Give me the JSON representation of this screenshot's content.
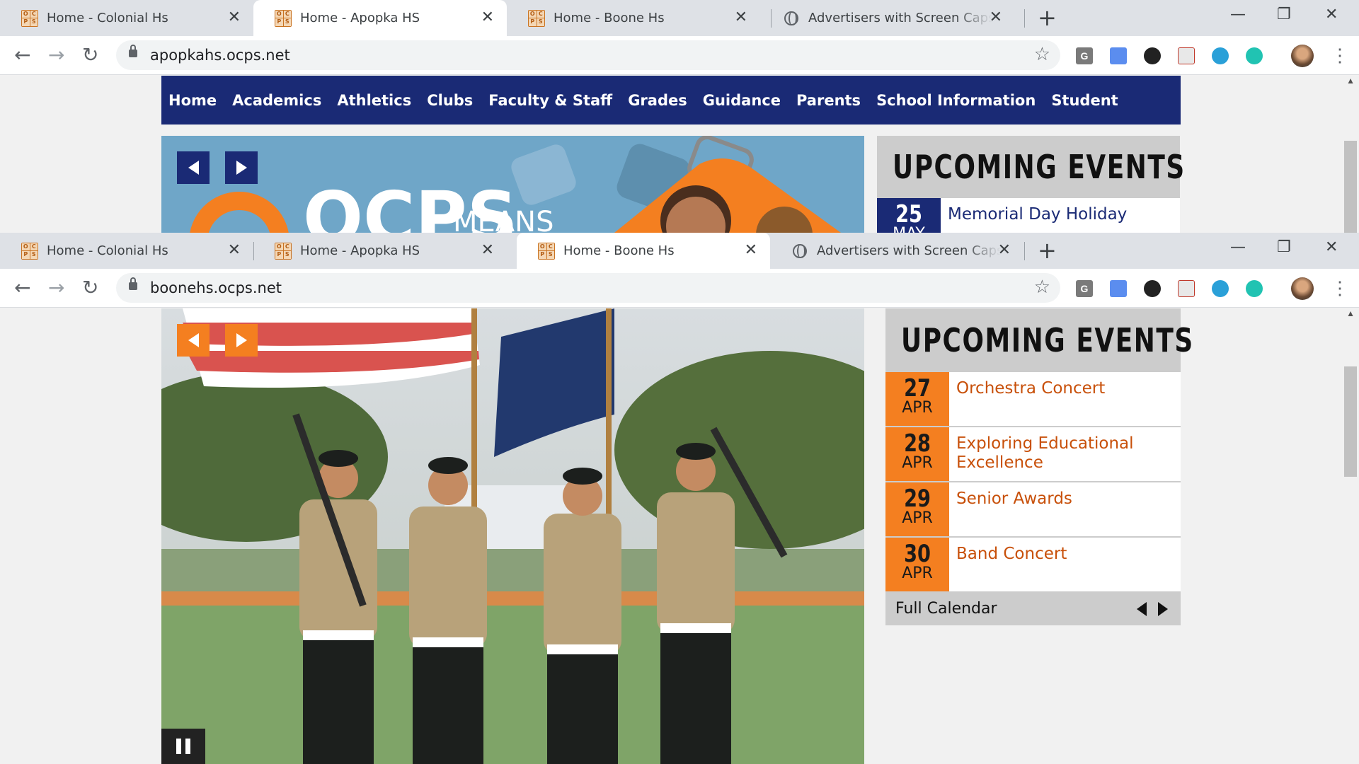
{
  "windows": [
    {
      "tabs": [
        {
          "title": "Home - Colonial Hs"
        },
        {
          "title": "Home - Apopka HS"
        },
        {
          "title": "Home - Boone Hs"
        },
        {
          "title": "Advertisers with Screen Caps of t"
        }
      ],
      "active_tab": 1,
      "url": "apopkahs.ocps.net",
      "nav": [
        "Home",
        "Academics",
        "Athletics",
        "Clubs",
        "Faculty & Staff",
        "Grades",
        "Guidance",
        "Parents",
        "School Information",
        "Student"
      ],
      "slide_text": {
        "brand": "OCPS",
        "tagline": "MEANS"
      },
      "events": {
        "heading": "UPCOMING EVENTS",
        "items": [
          {
            "day": "25",
            "month": "MAY",
            "title": "Memorial Day Holiday"
          }
        ]
      }
    },
    {
      "tabs": [
        {
          "title": "Home - Colonial Hs"
        },
        {
          "title": "Home - Apopka HS"
        },
        {
          "title": "Home - Boone Hs"
        },
        {
          "title": "Advertisers with Screen Caps of t"
        }
      ],
      "active_tab": 2,
      "url": "boonehs.ocps.net",
      "events": {
        "heading": "UPCOMING EVENTS",
        "items": [
          {
            "day": "27",
            "month": "APR",
            "title": "Orchestra Concert"
          },
          {
            "day": "28",
            "month": "APR",
            "title": "Exploring Educational Excellence"
          },
          {
            "day": "29",
            "month": "APR",
            "title": "Senior Awards"
          },
          {
            "day": "30",
            "month": "APR",
            "title": "Band Concert"
          }
        ],
        "footer": "Full Calendar"
      }
    }
  ],
  "icons": {
    "tab_close": "✕",
    "new_tab": "+",
    "back": "←",
    "forward": "→",
    "reload": "↻",
    "bookmark": "☆",
    "minimize": "—",
    "restore": "❐",
    "window_close": "✕",
    "menu": "⋮",
    "ext_g": "G"
  },
  "colors": {
    "apopka_nav": "#1a2a75",
    "apopka_accent": "#1a2a75",
    "boone_accent": "#f47f20",
    "boone_title": "#c8500a"
  }
}
